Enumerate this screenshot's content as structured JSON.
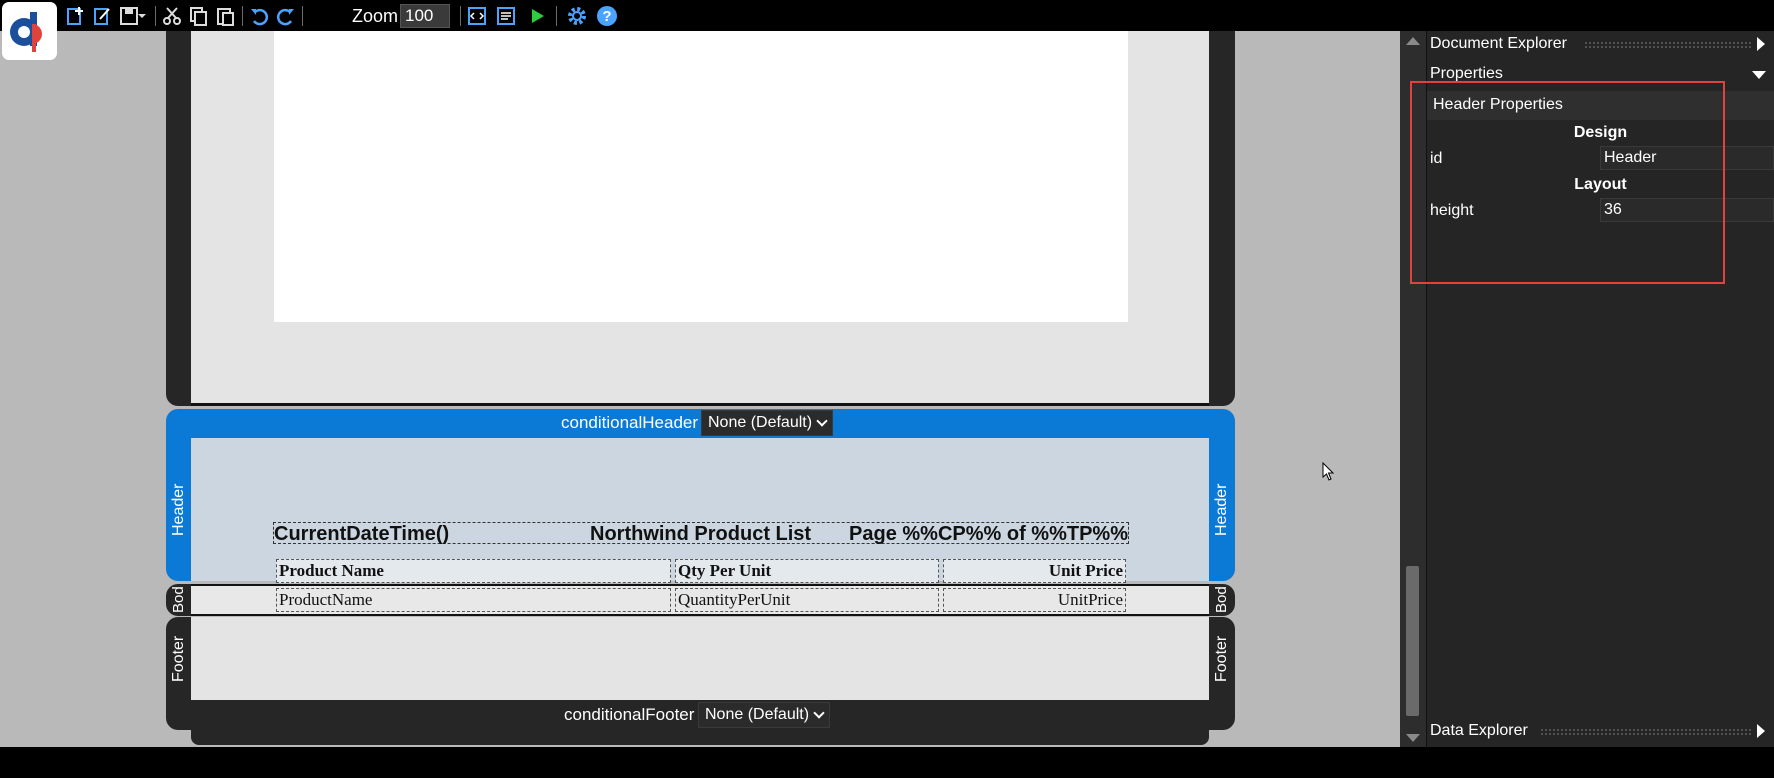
{
  "toolbar": {
    "zoom_label": "Zoom",
    "zoom_value": "100",
    "buttons": [
      "new-report",
      "edit-report",
      "save",
      "save-dropdown",
      "cut",
      "copy",
      "paste",
      "undo",
      "redo",
      "view-source",
      "preview",
      "run",
      "settings",
      "help"
    ]
  },
  "report": {
    "header_conditional_label": "conditionalHeader",
    "header_conditional_value": "None (Default)",
    "footer_conditional_label": "conditionalFooter",
    "footer_conditional_value": "None (Default)",
    "header_band_label": "Header",
    "body_band_label": "Bod",
    "footer_band_label": "Footer",
    "title_left": "CurrentDateTime()",
    "title_center": "Northwind Product List",
    "title_right": "Page %%CP%% of %%TP%%",
    "columns": [
      "Product Name",
      "Qty Per Unit",
      "Unit Price"
    ],
    "row": [
      "ProductName",
      "QuantityPerUnit",
      "UnitPrice"
    ]
  },
  "panel": {
    "document_explorer": "Document Explorer",
    "properties": "Properties",
    "data_explorer": "Data Explorer",
    "title": "Header Properties",
    "sections": [
      {
        "name": "Design",
        "props": [
          {
            "name": "id",
            "value": "Header"
          }
        ]
      },
      {
        "name": "Layout",
        "props": [
          {
            "name": "height",
            "value": "36"
          }
        ]
      }
    ]
  },
  "colors": {
    "accent": "#0a7ad6",
    "highlight": "#e0433c",
    "panel": "#252526"
  }
}
